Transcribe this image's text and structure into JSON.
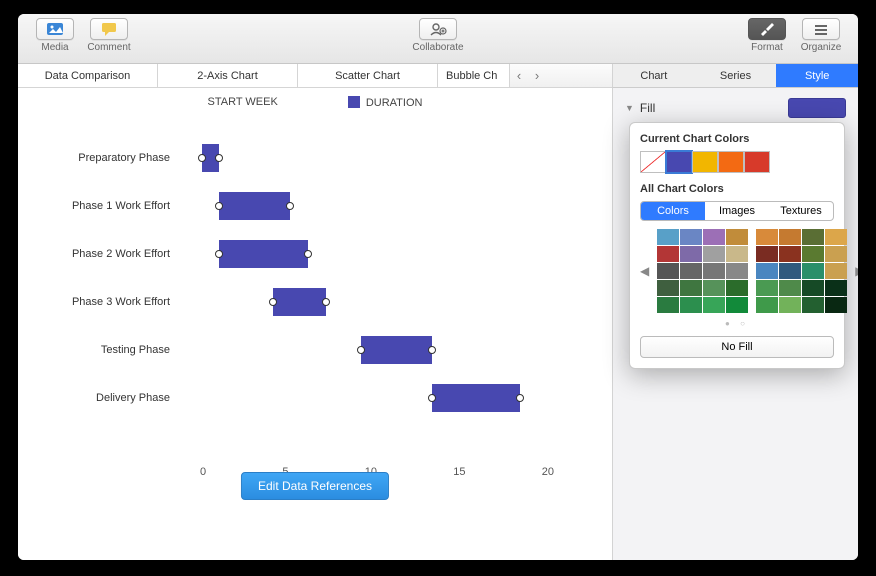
{
  "toolbar": {
    "media_label": "Media",
    "comment_label": "Comment",
    "collaborate_label": "Collaborate",
    "format_label": "Format",
    "organize_label": "Organize"
  },
  "chart_types": [
    "Data Comparison",
    "2-Axis Chart",
    "Scatter Chart",
    "Bubble Ch"
  ],
  "legend": {
    "series1": "START WEEK",
    "series2": "DURATION"
  },
  "chart_data": {
    "type": "bar",
    "orientation": "horizontal-range",
    "categories": [
      "Preparatory Phase",
      "Phase 1 Work Effort",
      "Phase 2 Work Effort",
      "Phase 3 Work Effort",
      "Testing Phase",
      "Delivery Phase"
    ],
    "series": [
      {
        "name": "START WEEK",
        "values": [
          1,
          2,
          2,
          5,
          10,
          14
        ]
      },
      {
        "name": "DURATION",
        "values": [
          1,
          4,
          5,
          3,
          4,
          5
        ]
      }
    ],
    "xlim": [
      0,
      20
    ],
    "xticks": [
      0,
      5,
      10,
      15,
      20
    ],
    "xlabel": "",
    "ylabel": "",
    "title": ""
  },
  "edit_button": "Edit Data References",
  "inspector": {
    "tabs": [
      "Chart",
      "Series",
      "Style"
    ],
    "active_tab": "Style",
    "fill_label": "Fill",
    "fill_color": "#4848b0"
  },
  "popover": {
    "current_label": "Current Chart Colors",
    "current_colors": [
      "nofill",
      "#4848b0",
      "#f2b600",
      "#f36a13",
      "#d73a2a"
    ],
    "current_selected": 1,
    "all_label": "All Chart Colors",
    "seg": [
      "Colors",
      "Images",
      "Textures"
    ],
    "seg_active": 0,
    "palette_left": [
      "#58a0c8",
      "#6a86c4",
      "#9c6fb6",
      "#c18c3a",
      "#b33636",
      "#7e6aa8",
      "#a0a0a0",
      "#c9b88a",
      "#555",
      "#666",
      "#777",
      "#888",
      "#3f5f3f",
      "#3f7640",
      "#56925a",
      "#2b6c2b",
      "#2a7b40",
      "#2c8f4e",
      "#37a558",
      "#128a3a"
    ],
    "palette_right": [
      "#d88a3a",
      "#c57a30",
      "#5a6e34",
      "#dca64a",
      "#7a2c22",
      "#8a321f",
      "#5a7a30",
      "#caa050",
      "#4a86c0",
      "#305a7e",
      "#2a8f6a",
      "#caa050",
      "#4a9a52",
      "#4f8a4a",
      "#164a26",
      "#0a3018",
      "#3f9a4a",
      "#72b25a",
      "#236030",
      "#092812"
    ],
    "nofill_label": "No Fill"
  }
}
